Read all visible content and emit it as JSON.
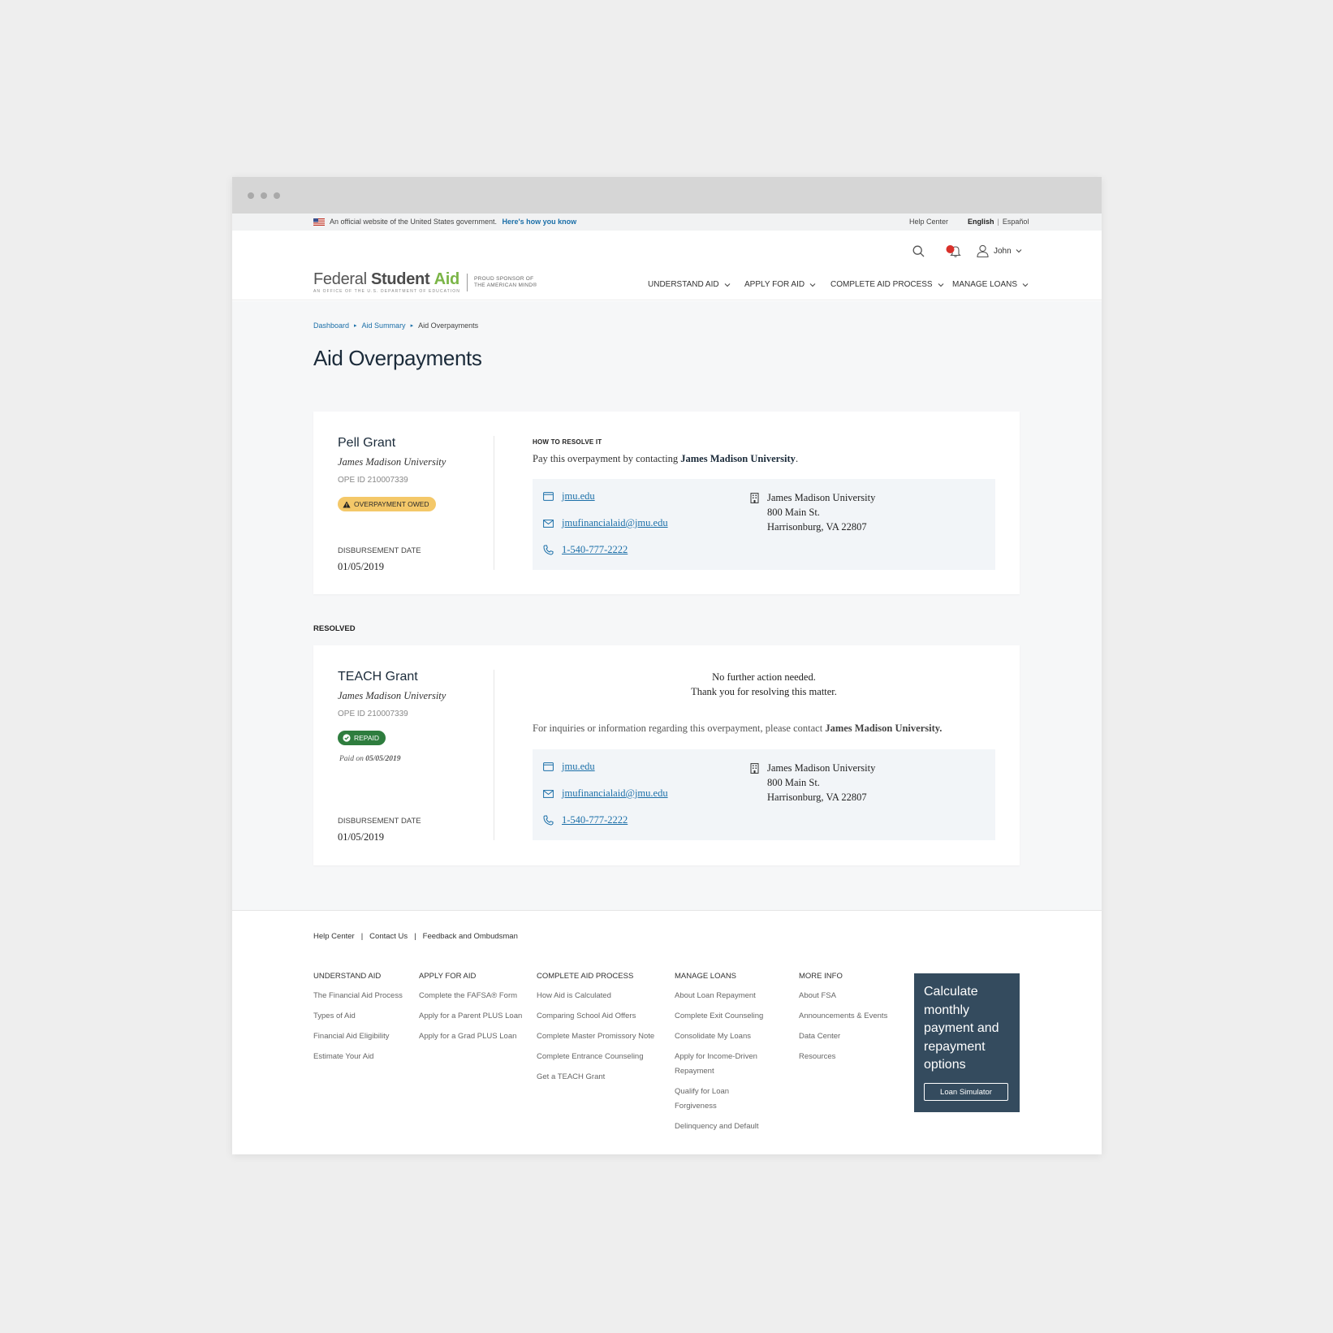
{
  "gov_banner": {
    "text": "An official website of the United States government.",
    "link": "Here's how you know",
    "help": "Help Center",
    "lang_active": "English",
    "lang_sep": "|",
    "lang_other": "Español"
  },
  "header": {
    "user_name": "John",
    "logo": {
      "federal": "Federal",
      "student": "Student",
      "aid": "Aid",
      "subline": "An OFFICE of the U.S. DEPARTMENT of EDUCATION",
      "sponsor_1": "PROUD SPONSOR of",
      "sponsor_2": "the AMERICAN MIND®"
    },
    "nav": [
      "UNDERSTAND AID",
      "APPLY FOR AID",
      "COMPLETE AID PROCESS",
      "MANAGE LOANS"
    ]
  },
  "breadcrumb": {
    "items": [
      "Dashboard",
      "Aid Summary"
    ],
    "current": "Aid Overpayments"
  },
  "page_title": "Aid Overpayments",
  "cards": [
    {
      "grant": "Pell Grant",
      "school": "James Madison University",
      "ope": "OPE ID 210007339",
      "badge": "OVERPAYMENT OWED",
      "disbursement_label": "DISBURSEMENT DATE",
      "disbursement_date": "01/05/2019",
      "resolve_label": "HOW TO RESOLVE IT",
      "resolve_text_1": "Pay this overpayment by contacting ",
      "resolve_school": "James Madison University",
      "resolve_text_2": ".",
      "contact": {
        "web": "jmu.edu",
        "email": "jmufinancialaid@jmu.edu",
        "phone": "1-540-777-2222",
        "addr_1": "James Madison University",
        "addr_2": "800 Main St.",
        "addr_3": "Harrisonburg, VA 22807"
      }
    },
    {
      "grant": "TEACH Grant",
      "school": "James Madison University",
      "ope": "OPE ID 210007339",
      "badge": "REPAID",
      "paid_on_label": "Paid on",
      "paid_on_date": "05/05/2019",
      "disbursement_label": "DISBURSEMENT DATE",
      "disbursement_date": "01/05/2019",
      "message_1": "No further action needed.",
      "message_2": "Thank you for resolving this matter.",
      "inquiry_text": "For inquiries or information regarding this overpayment, please contact ",
      "inquiry_school": "James Madison University.",
      "contact": {
        "web": "jmu.edu",
        "email": "jmufinancialaid@jmu.edu",
        "phone": "1-540-777-2222",
        "addr_1": "James Madison University",
        "addr_2": "800 Main St.",
        "addr_3": "Harrisonburg, VA 22807"
      }
    }
  ],
  "resolved_label": "RESOLVED",
  "footer": {
    "top_links": [
      "Help Center",
      "Contact Us",
      "Feedback and Ombudsman"
    ],
    "sep": "|",
    "columns": [
      {
        "head": "UNDERSTAND AID",
        "links": [
          "The Financial Aid Process",
          "Types of Aid",
          "Financial Aid Eligibility",
          "Estimate Your Aid"
        ]
      },
      {
        "head": "APPLY FOR AID",
        "links": [
          "Complete the FAFSA® Form",
          "Apply for a Parent PLUS Loan",
          "Apply for a Grad PLUS Loan"
        ]
      },
      {
        "head": "COMPLETE AID PROCESS",
        "links": [
          "How Aid is Calculated",
          "Comparing School Aid Offers",
          "Complete Master Promissory Note",
          "Complete Entrance Counseling",
          "Get a TEACH Grant"
        ]
      },
      {
        "head": "MANAGE LOANS",
        "links": [
          "About Loan Repayment",
          "Complete Exit Counseling",
          "Consolidate My Loans",
          "Apply for Income-Driven Repayment",
          "Qualify for Loan Forgiveness",
          "Delinquency and Default"
        ]
      },
      {
        "head": "MORE INFO",
        "links": [
          "About FSA",
          "Announcements & Events",
          "Data Center",
          "Resources"
        ]
      }
    ],
    "cta_text": "Calculate monthly payment and repayment options",
    "cta_button": "Loan Simulator"
  },
  "colors": {
    "accent": "#1b6fa8",
    "brand_green": "#7bb547",
    "warning": "#f4c869",
    "success": "#2e7d3e",
    "cta_bg": "#344b5e"
  }
}
